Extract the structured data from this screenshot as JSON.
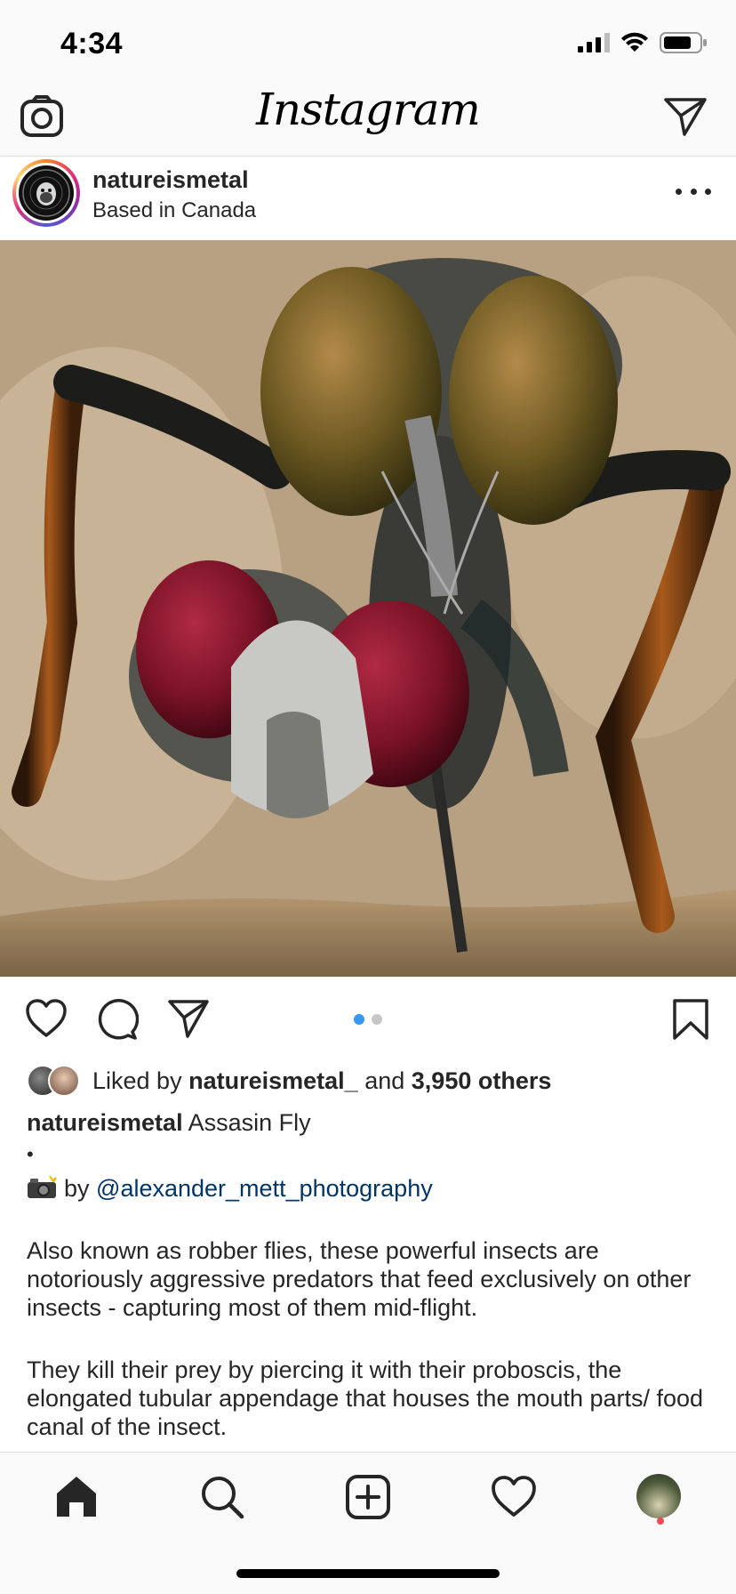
{
  "status_bar": {
    "time": "4:34"
  },
  "header": {
    "logo": "Instagram"
  },
  "post": {
    "username": "natureismetal",
    "location": "Based in Canada",
    "carousel": {
      "count": 2,
      "active_index": 0
    },
    "likes": {
      "prefix": "Liked by",
      "liker": "natureismetal_",
      "and_text": "and",
      "others": "3,950 others"
    },
    "caption": {
      "username": "natureismetal",
      "title": "Assasin Fly",
      "bullet": "•",
      "credit_by": "by",
      "credit_handle": "@alexander_mett_photography",
      "paragraph1": "Also known as robber flies, these powerful insects are notoriously aggressive predators that feed exclusively on other insects - capturing most of them mid-flight.",
      "paragraph2": "They kill their prey by piercing it with their proboscis, the elongated tubular appendage that houses the mouth parts/ food canal of the insect."
    }
  },
  "icons": {
    "camera": "camera-icon",
    "direct": "paper-plane-icon",
    "more": "more-horizontal-icon",
    "like": "heart-icon",
    "comment": "comment-icon",
    "share": "paper-plane-icon",
    "save": "bookmark-icon",
    "home": "home-icon",
    "search": "search-icon",
    "new_post": "plus-square-icon",
    "activity": "heart-icon"
  },
  "colors": {
    "link": "#003569",
    "carousel_active": "#3897f0",
    "notification_dot": "#ed4956"
  }
}
